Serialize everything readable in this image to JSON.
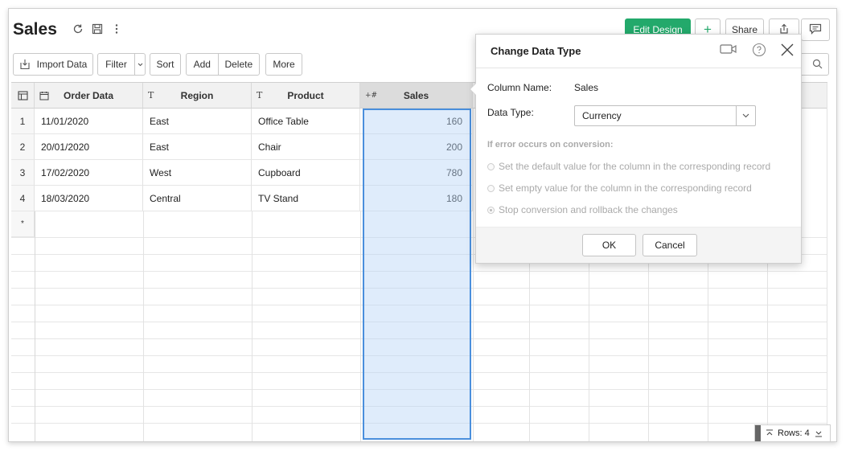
{
  "header": {
    "title": "Sales",
    "icons": [
      "refresh-icon",
      "save-icon",
      "more-vertical-icon"
    ],
    "edit_design_label": "Edit Design",
    "add_label": "+",
    "share_label": "Share"
  },
  "toolbar": {
    "import_label": "Import Data",
    "filter_label": "Filter",
    "sort_label": "Sort",
    "add_label": "Add",
    "delete_label": "Delete",
    "more_label": "More"
  },
  "table": {
    "columns": [
      {
        "type_icon": "",
        "label": "Order Data"
      },
      {
        "type_icon": "T",
        "label": "Region"
      },
      {
        "type_icon": "T",
        "label": "Product"
      },
      {
        "type_icon": "+#",
        "label": "Sales"
      }
    ],
    "rows": [
      {
        "num": "1",
        "order_date": "11/01/2020",
        "region": "East",
        "product": "Office Table",
        "sales": "160"
      },
      {
        "num": "2",
        "order_date": "20/01/2020",
        "region": "East",
        "product": "Chair",
        "sales": "200"
      },
      {
        "num": "3",
        "order_date": "17/02/2020",
        "region": "West",
        "product": "Cupboard",
        "sales": "780"
      },
      {
        "num": "4",
        "order_date": "18/03/2020",
        "region": "Central",
        "product": "TV Stand",
        "sales": "180"
      }
    ],
    "new_row_marker": "*",
    "rows_label": "Rows: 4"
  },
  "dialog": {
    "title": "Change Data Type",
    "column_name_label": "Column Name:",
    "column_name_value": "Sales",
    "data_type_label": "Data Type:",
    "data_type_value": "Currency",
    "error_heading": "If error occurs on conversion:",
    "options": [
      {
        "label": "Set the default value for the column in the corresponding record",
        "selected": false
      },
      {
        "label": "Set empty value for the column in the corresponding record",
        "selected": false
      },
      {
        "label": "Stop conversion and rollback the changes",
        "selected": true
      }
    ],
    "ok_label": "OK",
    "cancel_label": "Cancel"
  },
  "colors": {
    "accent_green": "#23a96b",
    "selection_border": "#4a8fdc",
    "selection_fill": "#dce9fa"
  }
}
